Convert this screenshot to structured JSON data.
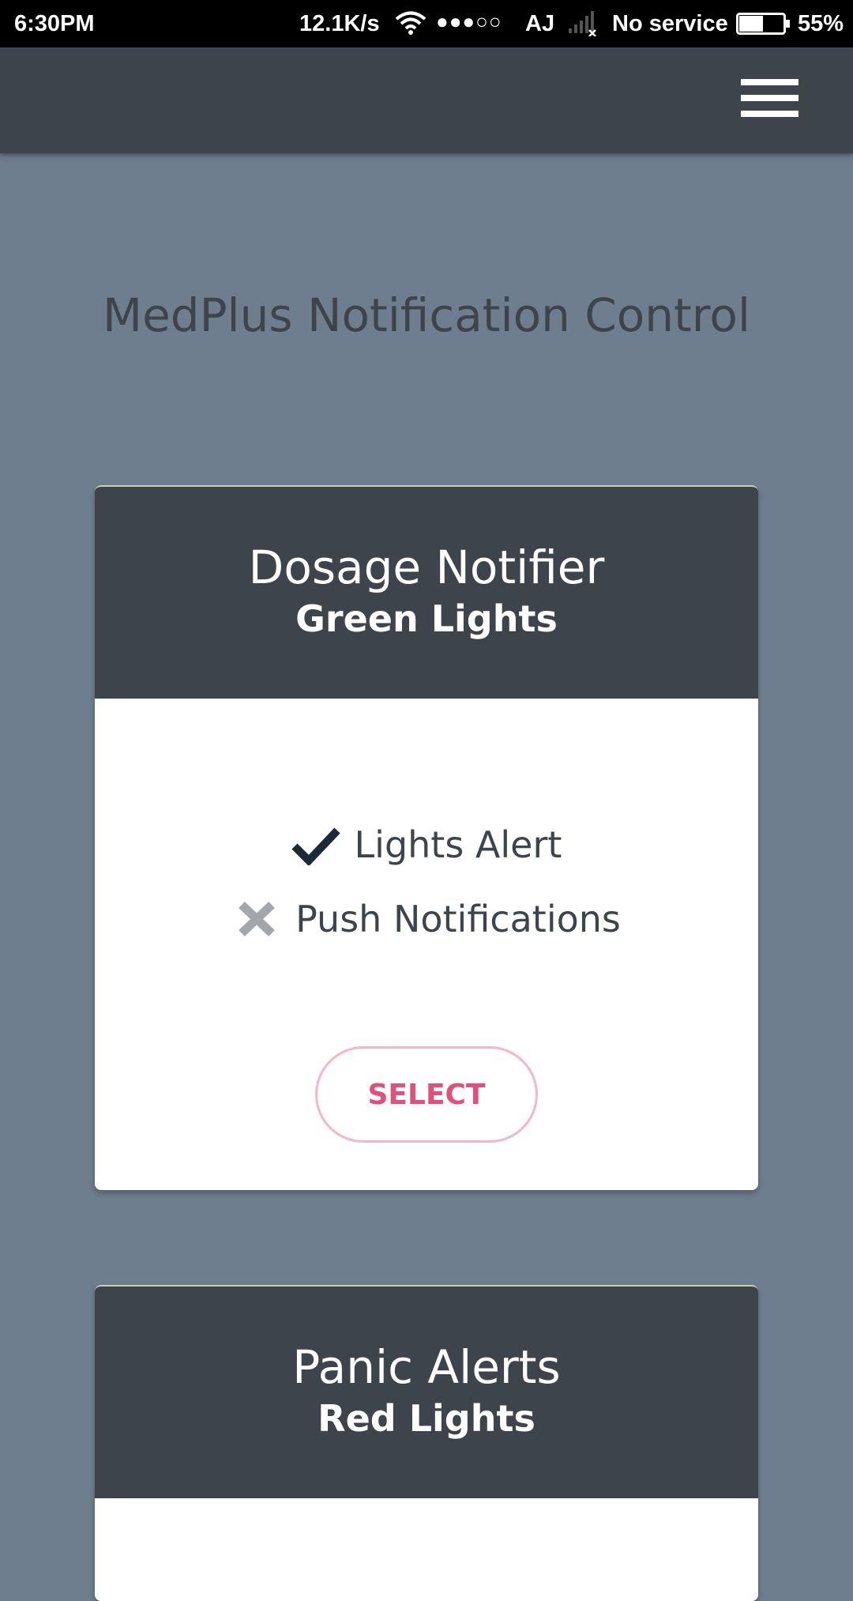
{
  "status_bar": {
    "time": "6:30PM",
    "speed": "12.1K/s",
    "sim_dots": "●●●○○",
    "carrier": "AJ",
    "service": "No service",
    "battery_level": 0.55,
    "battery_pct": "55%"
  },
  "app_bar": {
    "menu_icon": "hamburger-menu-icon"
  },
  "page": {
    "title": "MedPlus Notification Control"
  },
  "cards": [
    {
      "title": "Dosage Notifier",
      "subtitle": "Green Lights",
      "features": [
        {
          "label": "Lights Alert",
          "icon": "check-icon",
          "enabled": true
        },
        {
          "label": "Push Notifications",
          "icon": "cross-icon",
          "enabled": false
        }
      ],
      "button_label": "SELECT"
    },
    {
      "title": "Panic Alerts",
      "subtitle": "Red Lights"
    }
  ],
  "colors": {
    "background": "#6e7e8e",
    "dark": "#3e444c",
    "accent": "#e0507a",
    "button_border": "#f3b8c8",
    "check": "#1c2a38",
    "cross": "#a3a7ab"
  }
}
